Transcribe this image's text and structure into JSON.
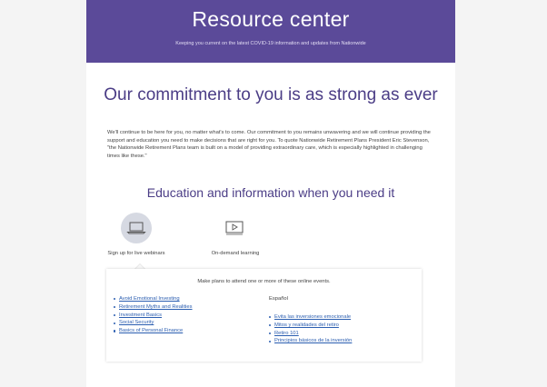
{
  "hero": {
    "title": "Resource center",
    "subtitle": "Keeping you current on the latest COVID-19 information and updates from Nationwide"
  },
  "commitment": {
    "title": "Our commitment to you is as strong as ever",
    "body": "We'll continue to be here for you, no matter what's to come. Our commitment to you remains unwavering and we will continue providing the support and education you need to make decisions that are right for you. To quote Nationwide Retirement Plans President Eric Stevenson, \"the Nationwide Retirement Plans team is built on a model of providing extraordinary care, which is especially highlighted in challenging times like these.\""
  },
  "education": {
    "title": "Education and information when you need it",
    "tabs": [
      {
        "label": "Sign up for live webinars",
        "icon": "laptop-icon",
        "active": true
      },
      {
        "label": "On-demand learning",
        "icon": "video-play-icon",
        "active": false
      }
    ]
  },
  "panel": {
    "intro": "Make plans to attend one or more of these online events.",
    "english_links": [
      "Avoid Emotional Investing",
      "Retirement Myths and Realities",
      "Investment Basics",
      "Social Security",
      "Basics of Personal Finance"
    ],
    "spanish_label": "Español",
    "spanish_links": [
      "Evita las inversiones emocionale",
      "Mitos y realidades del retiro",
      "Retiro 101",
      "Principios básicos de la inversión"
    ]
  },
  "colors": {
    "brand_purple": "#5b4a99",
    "heading_purple": "#4b3d86",
    "link_blue": "#2a5db0"
  }
}
